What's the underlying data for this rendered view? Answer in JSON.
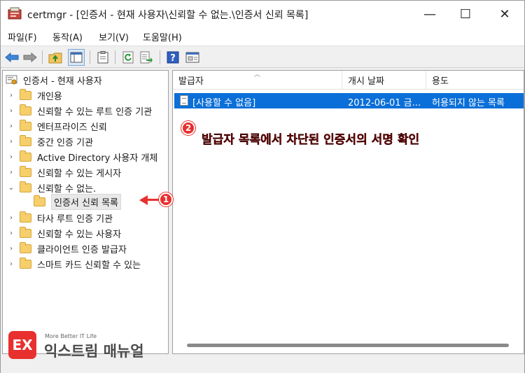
{
  "window": {
    "title": "certmgr - [인증서 - 현재 사용자\\신뢰할 수 없는.\\인증서 신뢰 목록]",
    "minimize_glyph": "—",
    "maximize_glyph": "☐",
    "close_glyph": "✕"
  },
  "menu": {
    "items": [
      {
        "label": "파일(F)"
      },
      {
        "label": "동작(A)"
      },
      {
        "label": "보기(V)"
      },
      {
        "label": "도움말(H)"
      }
    ]
  },
  "toolbar": {
    "buttons": [
      {
        "icon": "back-arrow-icon"
      },
      {
        "icon": "forward-arrow-icon"
      },
      {
        "icon": "up-folder-icon"
      },
      {
        "icon": "show-hide-tree-icon"
      },
      {
        "icon": "clipboard-icon"
      },
      {
        "icon": "refresh-icon"
      },
      {
        "icon": "export-list-icon"
      },
      {
        "icon": "help-icon"
      },
      {
        "icon": "properties-icon"
      }
    ]
  },
  "tree": {
    "root": "인증서 - 현재 사용자",
    "items": [
      {
        "label": "개인용",
        "arrow": "›"
      },
      {
        "label": "신뢰할 수 있는 루트 인증 기관",
        "arrow": "›"
      },
      {
        "label": "엔터프라이즈 신뢰",
        "arrow": "›"
      },
      {
        "label": "중간 인증 기관",
        "arrow": "›"
      },
      {
        "label": "Active Directory 사용자 개체",
        "arrow": "›"
      },
      {
        "label": "신뢰할 수 있는 게시자",
        "arrow": "›"
      },
      {
        "label": "신뢰할 수 없는.",
        "arrow": "⌄"
      },
      {
        "label": "인증서 신뢰 목록",
        "arrow": ""
      },
      {
        "label": "타사 루트 인증 기관",
        "arrow": "›"
      },
      {
        "label": "신뢰할 수 있는 사용자",
        "arrow": "›"
      },
      {
        "label": "클라이언트 인증 발급자",
        "arrow": "›"
      },
      {
        "label": "스마트 카드 신뢰할 수 있는",
        "arrow": "›"
      }
    ]
  },
  "list": {
    "columns": [
      "발급자",
      "개시 날짜",
      "용도"
    ],
    "rows": [
      {
        "issuer": "[사용할 수 없음]",
        "start_date": "2012-06-01 금...",
        "purpose": "허용되지 않는 목록"
      }
    ]
  },
  "annotations": {
    "badge1": "1",
    "badge2": "2",
    "text2": "발급자 목록에서 차단된 인증서의 서명 확인",
    "color": "#e8302f"
  },
  "watermark": {
    "logo": "EX",
    "tagline": "More Better IT Life",
    "name": "익스트림 매뉴얼"
  }
}
